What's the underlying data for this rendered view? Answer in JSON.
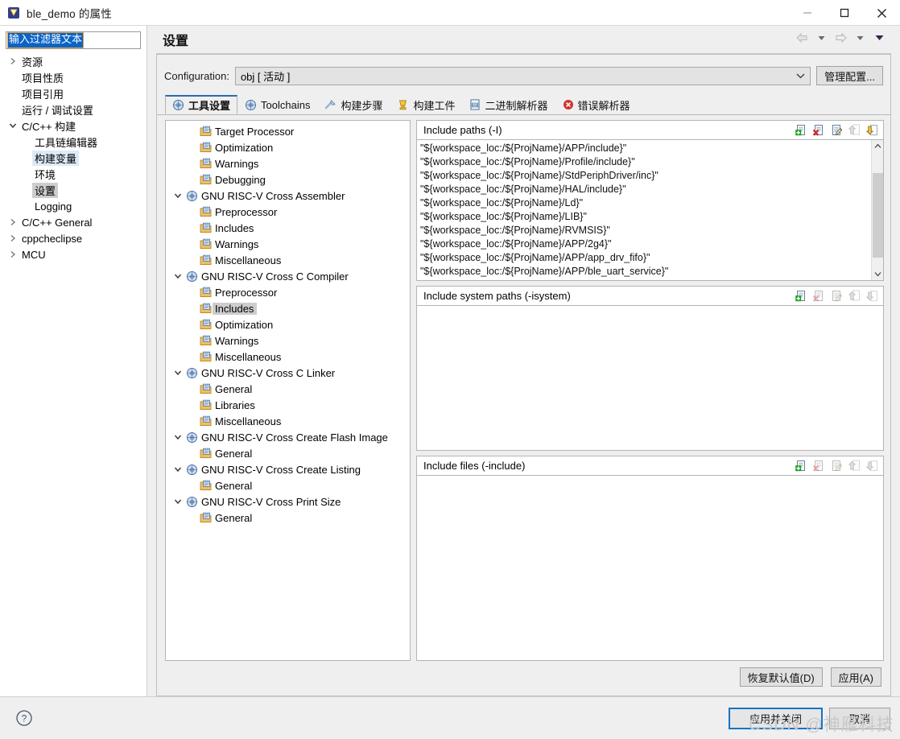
{
  "window": {
    "title": "ble_demo 的属性",
    "icon": "eclipse-project-icon",
    "minimize_label": "—",
    "maximize_label": "□",
    "close_label": "✕"
  },
  "filter": {
    "value": "输入过滤器文本"
  },
  "sidebar": {
    "items": [
      {
        "label": "资源",
        "arrow": "collapsed",
        "indent": 0,
        "highlight": "none"
      },
      {
        "label": "项目性质",
        "arrow": "none",
        "indent": 0,
        "highlight": "none"
      },
      {
        "label": "项目引用",
        "arrow": "none",
        "indent": 0,
        "highlight": "none"
      },
      {
        "label": "运行 / 调试设置",
        "arrow": "none",
        "indent": 0,
        "highlight": "none"
      },
      {
        "label": "C/C++ 构建",
        "arrow": "expanded",
        "indent": 0,
        "highlight": "none"
      },
      {
        "label": "工具链编辑器",
        "arrow": "none",
        "indent": 1,
        "highlight": "none"
      },
      {
        "label": "构建变量",
        "arrow": "none",
        "indent": 1,
        "highlight": "blue"
      },
      {
        "label": "环境",
        "arrow": "none",
        "indent": 1,
        "highlight": "none"
      },
      {
        "label": "设置",
        "arrow": "none",
        "indent": 1,
        "highlight": "gray"
      },
      {
        "label": "Logging",
        "arrow": "none",
        "indent": 1,
        "highlight": "none"
      },
      {
        "label": "C/C++ General",
        "arrow": "collapsed",
        "indent": 0,
        "highlight": "none"
      },
      {
        "label": "cppcheclipse",
        "arrow": "collapsed",
        "indent": 0,
        "highlight": "none"
      },
      {
        "label": "MCU",
        "arrow": "collapsed",
        "indent": 0,
        "highlight": "none"
      }
    ]
  },
  "page": {
    "title": "设置",
    "nav": {
      "back": "back-arrow",
      "back_menu": "chevron-down",
      "forward": "forward-arrow",
      "forward_menu": "chevron-down",
      "view_menu": "view-menu-triangle"
    }
  },
  "configuration": {
    "label": "Configuration:",
    "value": "obj  [ 活动 ]",
    "manage_button": "管理配置..."
  },
  "tabs": [
    {
      "label": "工具设置",
      "icon": "tool-settings-icon",
      "active": true
    },
    {
      "label": "Toolchains",
      "icon": "toolchains-icon",
      "active": false
    },
    {
      "label": "构建步骤",
      "icon": "build-steps-icon",
      "active": false
    },
    {
      "label": "构建工件",
      "icon": "build-artifact-icon",
      "active": false
    },
    {
      "label": "二进制解析器",
      "icon": "binary-parser-icon",
      "active": false
    },
    {
      "label": "错误解析器",
      "icon": "error-parser-icon",
      "active": false
    }
  ],
  "tool_tree": [
    {
      "label": "Target Processor",
      "level": 1,
      "arrow": "none",
      "icon": "folder-page-icon",
      "selected": false
    },
    {
      "label": "Optimization",
      "level": 1,
      "arrow": "none",
      "icon": "folder-page-icon",
      "selected": false
    },
    {
      "label": "Warnings",
      "level": 1,
      "arrow": "none",
      "icon": "folder-page-icon",
      "selected": false
    },
    {
      "label": "Debugging",
      "level": 1,
      "arrow": "none",
      "icon": "folder-page-icon",
      "selected": false
    },
    {
      "label": "GNU RISC-V Cross Assembler",
      "level": 0,
      "arrow": "expanded",
      "icon": "tool-icon",
      "selected": false
    },
    {
      "label": "Preprocessor",
      "level": 1,
      "arrow": "none",
      "icon": "folder-page-icon",
      "selected": false
    },
    {
      "label": "Includes",
      "level": 1,
      "arrow": "none",
      "icon": "folder-page-icon",
      "selected": false
    },
    {
      "label": "Warnings",
      "level": 1,
      "arrow": "none",
      "icon": "folder-page-icon",
      "selected": false
    },
    {
      "label": "Miscellaneous",
      "level": 1,
      "arrow": "none",
      "icon": "folder-page-icon",
      "selected": false
    },
    {
      "label": "GNU RISC-V Cross C Compiler",
      "level": 0,
      "arrow": "expanded",
      "icon": "tool-icon",
      "selected": false
    },
    {
      "label": "Preprocessor",
      "level": 1,
      "arrow": "none",
      "icon": "folder-page-icon",
      "selected": false
    },
    {
      "label": "Includes",
      "level": 1,
      "arrow": "none",
      "icon": "folder-page-icon",
      "selected": true
    },
    {
      "label": "Optimization",
      "level": 1,
      "arrow": "none",
      "icon": "folder-page-icon",
      "selected": false
    },
    {
      "label": "Warnings",
      "level": 1,
      "arrow": "none",
      "icon": "folder-page-icon",
      "selected": false
    },
    {
      "label": "Miscellaneous",
      "level": 1,
      "arrow": "none",
      "icon": "folder-page-icon",
      "selected": false
    },
    {
      "label": "GNU RISC-V Cross C Linker",
      "level": 0,
      "arrow": "expanded",
      "icon": "tool-icon",
      "selected": false
    },
    {
      "label": "General",
      "level": 1,
      "arrow": "none",
      "icon": "folder-page-icon",
      "selected": false
    },
    {
      "label": "Libraries",
      "level": 1,
      "arrow": "none",
      "icon": "folder-page-icon",
      "selected": false
    },
    {
      "label": "Miscellaneous",
      "level": 1,
      "arrow": "none",
      "icon": "folder-page-icon",
      "selected": false
    },
    {
      "label": "GNU RISC-V Cross Create Flash Image",
      "level": 0,
      "arrow": "expanded",
      "icon": "tool-icon",
      "selected": false
    },
    {
      "label": "General",
      "level": 1,
      "arrow": "none",
      "icon": "folder-page-icon",
      "selected": false
    },
    {
      "label": "GNU RISC-V Cross Create Listing",
      "level": 0,
      "arrow": "expanded",
      "icon": "tool-icon",
      "selected": false
    },
    {
      "label": "General",
      "level": 1,
      "arrow": "none",
      "icon": "folder-page-icon",
      "selected": false
    },
    {
      "label": "GNU RISC-V Cross Print Size",
      "level": 0,
      "arrow": "expanded",
      "icon": "tool-icon",
      "selected": false
    },
    {
      "label": "General",
      "level": 1,
      "arrow": "none",
      "icon": "folder-page-icon",
      "selected": false
    }
  ],
  "option_groups": [
    {
      "title": "Include paths (-I)",
      "toolbar": [
        {
          "name": "add-icon",
          "enabled": true
        },
        {
          "name": "delete-icon",
          "enabled": true
        },
        {
          "name": "edit-icon",
          "enabled": true
        },
        {
          "name": "move-up-icon",
          "enabled": false
        },
        {
          "name": "move-down-icon",
          "enabled": true
        }
      ],
      "scrollbar": true,
      "items": [
        "\"${workspace_loc:/${ProjName}/APP/include}\"",
        "\"${workspace_loc:/${ProjName}/Profile/include}\"",
        "\"${workspace_loc:/${ProjName}/StdPeriphDriver/inc}\"",
        "\"${workspace_loc:/${ProjName}/HAL/include}\"",
        "\"${workspace_loc:/${ProjName}/Ld}\"",
        "\"${workspace_loc:/${ProjName}/LIB}\"",
        "\"${workspace_loc:/${ProjName}/RVMSIS}\"",
        "\"${workspace_loc:/${ProjName}/APP/2g4}\"",
        "\"${workspace_loc:/${ProjName}/APP/app_drv_fifo}\"",
        "\"${workspace_loc:/${ProjName}/APP/ble_uart_service}\""
      ]
    },
    {
      "title": "Include system paths (-isystem)",
      "toolbar": [
        {
          "name": "add-icon",
          "enabled": true
        },
        {
          "name": "delete-icon",
          "enabled": false
        },
        {
          "name": "edit-icon",
          "enabled": false
        },
        {
          "name": "move-up-icon",
          "enabled": false
        },
        {
          "name": "move-down-icon",
          "enabled": false
        }
      ],
      "scrollbar": false,
      "items": []
    },
    {
      "title": "Include files (-include)",
      "toolbar": [
        {
          "name": "add-icon",
          "enabled": true
        },
        {
          "name": "delete-icon",
          "enabled": false
        },
        {
          "name": "edit-icon",
          "enabled": false
        },
        {
          "name": "move-up-icon",
          "enabled": false
        },
        {
          "name": "move-down-icon",
          "enabled": false
        }
      ],
      "scrollbar": false,
      "items": []
    }
  ],
  "content_footer": {
    "restore_defaults": "恢复默认值(D)",
    "apply": "应用(A)"
  },
  "bottom": {
    "help": "help-icon",
    "apply_and_close": "应用并关闭",
    "cancel": "取消"
  },
  "watermark": "CSDN @神雁科技"
}
